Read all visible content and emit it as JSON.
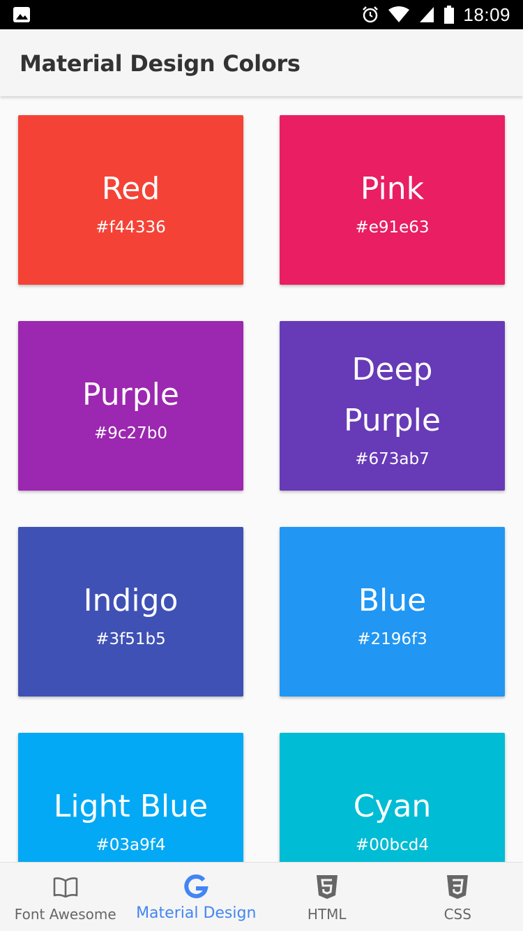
{
  "status_bar": {
    "time": "18:09",
    "icons": [
      "image-notification-icon",
      "alarm-icon",
      "wifi-icon",
      "signal-icon",
      "battery-icon"
    ]
  },
  "app_bar": {
    "title": "Material Design Colors"
  },
  "colors": [
    {
      "name": "Red",
      "hex": "#f44336"
    },
    {
      "name": "Pink",
      "hex": "#e91e63"
    },
    {
      "name": "Purple",
      "hex": "#9c27b0"
    },
    {
      "name": "Deep Purple",
      "hex": "#673ab7"
    },
    {
      "name": "Indigo",
      "hex": "#3f51b5"
    },
    {
      "name": "Blue",
      "hex": "#2196f3"
    },
    {
      "name": "Light Blue",
      "hex": "#03a9f4"
    },
    {
      "name": "Cyan",
      "hex": "#00bcd4"
    }
  ],
  "bottom_nav": {
    "active_color": "#4285f4",
    "inactive_color": "#666666",
    "items": [
      {
        "label": "Font Awesome",
        "icon": "book-open-icon",
        "active": false
      },
      {
        "label": "Material Design",
        "icon": "google-g-icon",
        "active": true
      },
      {
        "label": "HTML",
        "icon": "html5-icon",
        "active": false
      },
      {
        "label": "CSS",
        "icon": "css3-icon",
        "active": false
      }
    ]
  }
}
